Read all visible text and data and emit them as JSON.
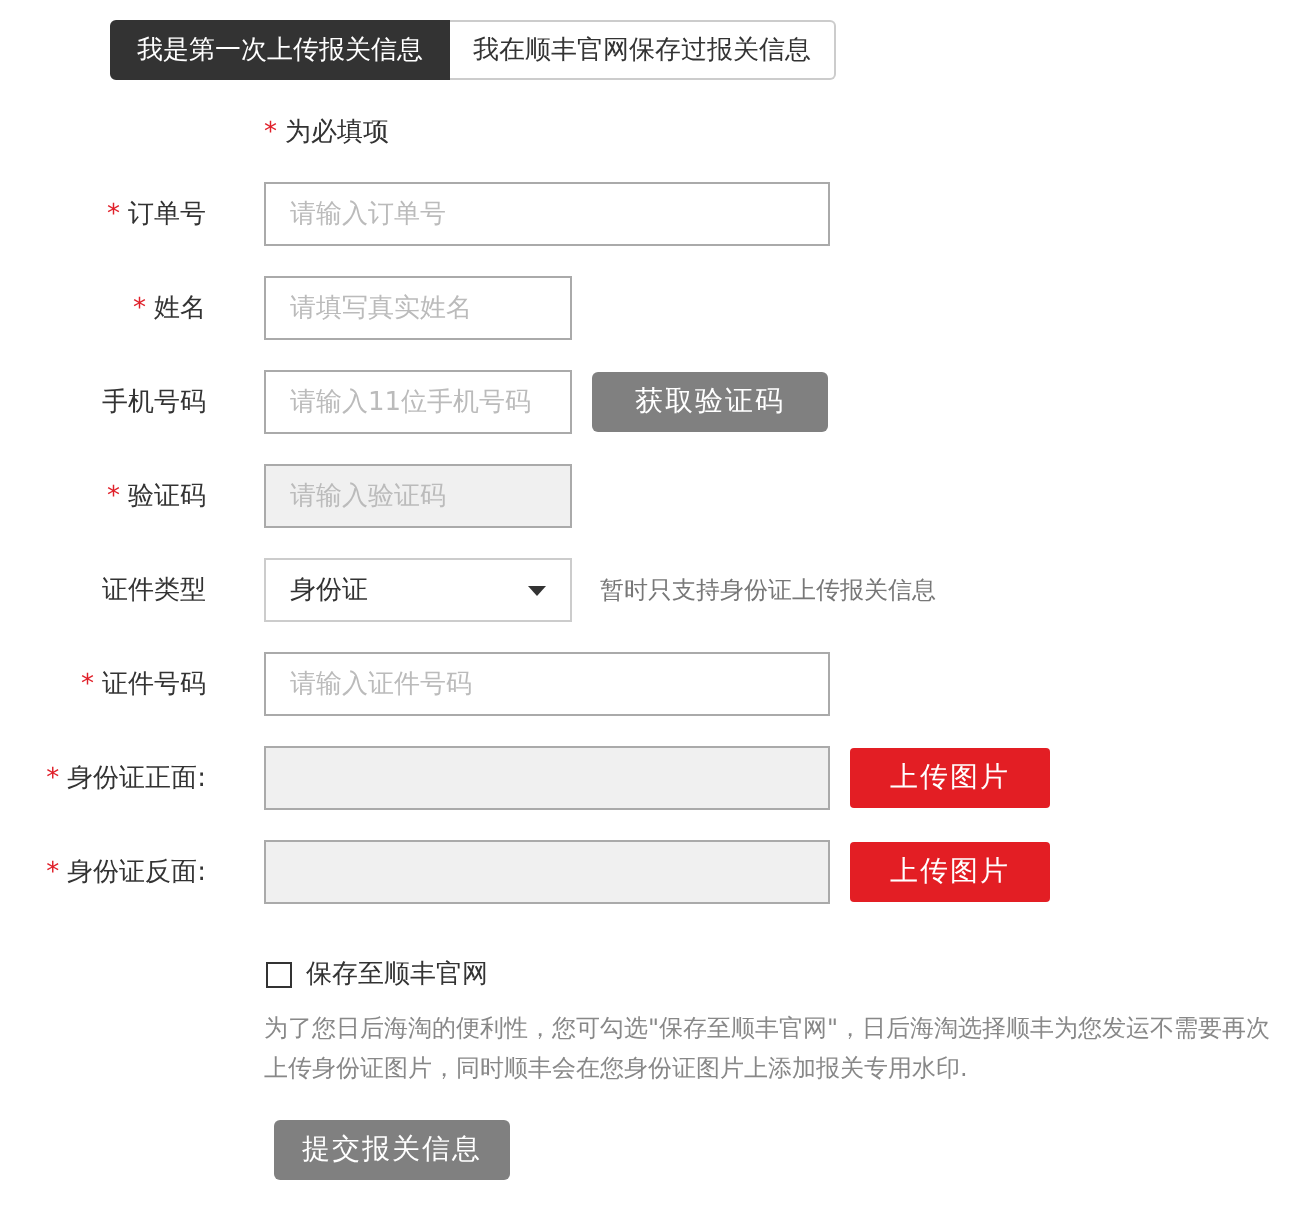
{
  "tabs": [
    {
      "label": "我是第一次上传报关信息",
      "selected": true
    },
    {
      "label": "我在顺丰官网保存过报关信息",
      "selected": false
    }
  ],
  "required_note": {
    "mark": "*",
    "text": "为必填项"
  },
  "fields": [
    {
      "kind": "input",
      "label": "订单号",
      "required": true,
      "placeholder": "请输入订单号",
      "wide": true,
      "disabled": false
    },
    {
      "kind": "input",
      "label": "姓名",
      "required": true,
      "placeholder": "请填写真实姓名",
      "wide": false,
      "disabled": false
    },
    {
      "kind": "input",
      "label": "手机号码",
      "required": false,
      "placeholder": "请输入11位手机号码",
      "wide": false,
      "disabled": false,
      "button": "获取验证码"
    },
    {
      "kind": "input",
      "label": "验证码",
      "required": true,
      "placeholder": "请输入验证码",
      "wide": false,
      "disabled": true
    },
    {
      "kind": "select",
      "label": "证件类型",
      "required": false,
      "value": "身份证",
      "note": "暂时只支持身份证上传报关信息"
    },
    {
      "kind": "input",
      "label": "证件号码",
      "required": true,
      "placeholder": "请输入证件号码",
      "wide": true,
      "disabled": false
    },
    {
      "kind": "upload",
      "label": "身份证正面:",
      "required": true,
      "button": "上传图片"
    },
    {
      "kind": "upload",
      "label": "身份证反面:",
      "required": true,
      "button": "上传图片"
    }
  ],
  "save_option": {
    "label": "保存至顺丰官网",
    "checked": false
  },
  "description": "为了您日后海淘的便利性，您可勾选\"保存至顺丰官网\"，日后海淘选择顺丰为您发运不需要再次上传身份证图片，同时顺丰会在您身份证图片上添加报关专用水印.",
  "submit": "提交报关信息"
}
